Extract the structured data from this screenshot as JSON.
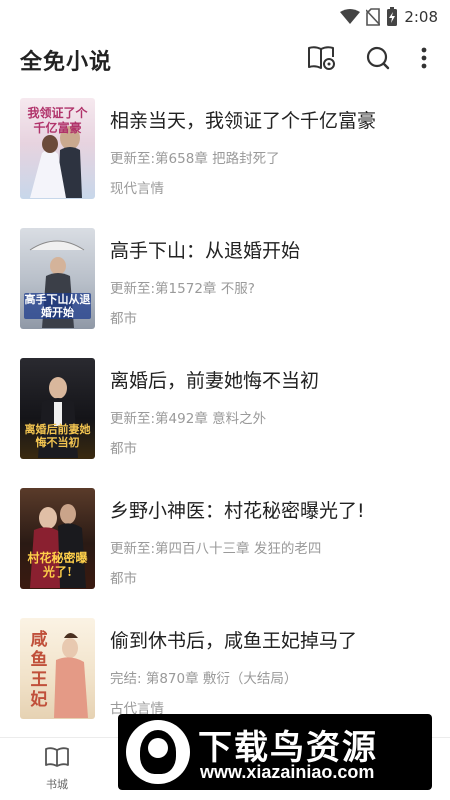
{
  "status_bar": {
    "time": "2:08"
  },
  "app_bar": {
    "title": "全免小说",
    "actions": [
      "book-search-icon",
      "search-icon",
      "more-vert-icon"
    ]
  },
  "books": [
    {
      "title": "相亲当天，我领证了个千亿富豪",
      "latest": "更新至:第658章 把路封死了",
      "genre": "现代言情",
      "cover_text": "我领证了个千亿富豪"
    },
    {
      "title": "高手下山：从退婚开始",
      "latest": "更新至:第1572章 不服?",
      "genre": "都市",
      "cover_text": "高手下山从退婚开始"
    },
    {
      "title": "离婚后，前妻她悔不当初",
      "latest": "更新至:第492章 意料之外",
      "genre": "都市",
      "cover_text": "离婚后前妻她悔不当初"
    },
    {
      "title": "乡野小神医：村花秘密曝光了!",
      "latest": "更新至:第四百八十三章 发狂的老四",
      "genre": "都市",
      "cover_text": "村花秘密曝光了!"
    },
    {
      "title": "偷到休书后，咸鱼王妃掉马了",
      "latest": "完结: 第870章 敷衍（大结局）",
      "genre": "古代言情",
      "cover_text": "咸鱼王妃"
    }
  ],
  "bottom_nav": {
    "items": [
      {
        "label": "书城",
        "icon": "book-open-icon"
      }
    ]
  },
  "watermark": {
    "title": "下载鸟资源",
    "url": "www.xiazainiao.com"
  },
  "colors": {
    "title": "#222222",
    "secondary": "#9a9a9a",
    "divider": "#ececec"
  }
}
